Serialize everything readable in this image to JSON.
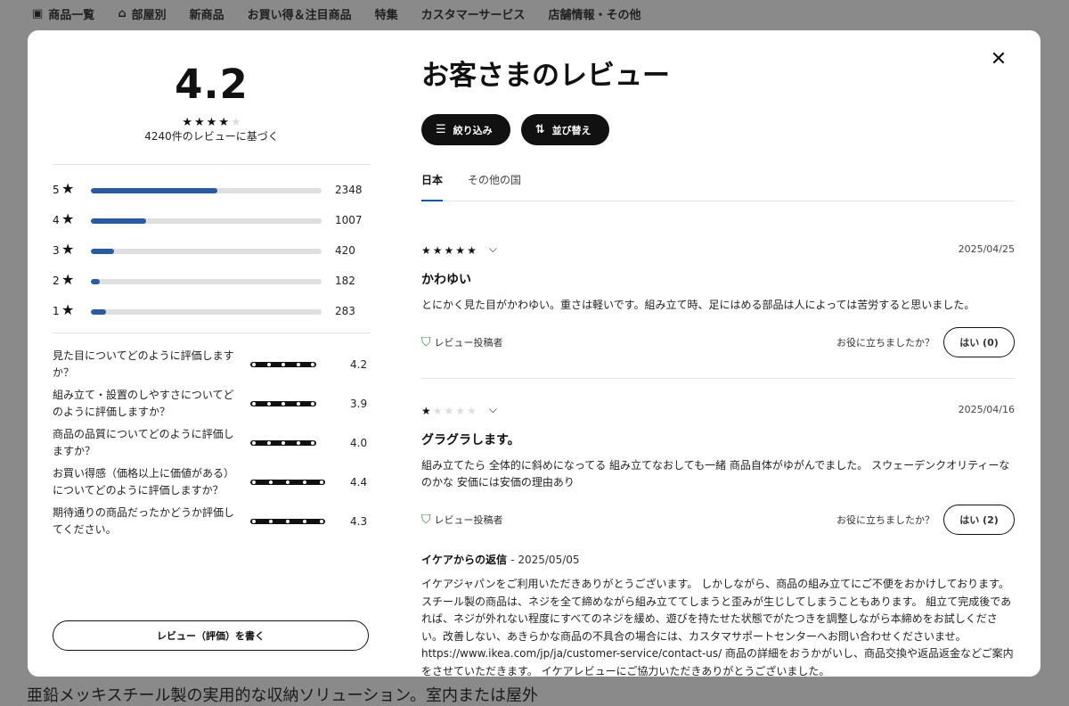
{
  "nav": {
    "items": [
      {
        "label": "商品一覧",
        "icon": "catalog-icon"
      },
      {
        "label": "部屋別",
        "icon": "home-icon"
      },
      {
        "label": "新商品"
      },
      {
        "label": "お買い得＆注目商品"
      },
      {
        "label": "特集"
      },
      {
        "label": "カスタマーサービス"
      },
      {
        "label": "店舗情報・その他"
      }
    ]
  },
  "background_text": "亜鉛メッキスチール製の実用的な収納ソリューション。室内または屋外",
  "summary": {
    "average": "4.2",
    "average_stars": 4,
    "caption": "4240件のレビューに基づく",
    "histogram": [
      {
        "stars": "5",
        "count": "2348",
        "fraction": 0.55
      },
      {
        "stars": "4",
        "count": "1007",
        "fraction": 0.24
      },
      {
        "stars": "3",
        "count": "420",
        "fraction": 0.1
      },
      {
        "stars": "2",
        "count": "182",
        "fraction": 0.04
      },
      {
        "stars": "1",
        "count": "283",
        "fraction": 0.065
      }
    ],
    "sub_ratings": [
      {
        "question": "見た目についてどのように評価しますか？",
        "value": "4.2"
      },
      {
        "question": "組み立て・設置のしやすさについてどのように評価しますか？",
        "value": "3.9"
      },
      {
        "question": "商品の品質についてどのように評価しますか？",
        "value": "4.0"
      },
      {
        "question": "お買い得感（価格以上に価値がある）についてどのように評価しますか？",
        "value": "4.4"
      },
      {
        "question": "期待通りの商品だったかどうか評価してください。",
        "value": "4.3"
      }
    ],
    "write_button": "レビュー（評価）を書く"
  },
  "reviews_panel": {
    "title": "お客さまのレビュー",
    "filter_button": "絞り込み",
    "sort_button": "並び替え",
    "tabs": [
      {
        "label": "日本",
        "active": true
      },
      {
        "label": "その他の国",
        "active": false
      }
    ],
    "reviews": [
      {
        "rating": 5,
        "date": "2025/04/25",
        "title": "かわゆい",
        "body": "とにかく見た目がかわゆい。重さは軽いです。組み立て時、足にはめる部品は人によっては苦労すると思いました。",
        "badge": "レビュー投稿者",
        "helpful_question": "お役に立ちましたか？",
        "helpful_button": "はい (0)"
      },
      {
        "rating": 1,
        "date": "2025/04/16",
        "title": "グラグラします。",
        "body": "組み立てたら 全体的に斜めになってる 組み立てなおしても一緒 商品自体がゆがんでました。 スウェーデンクオリティーなのかな 安価には安価の理由あり",
        "badge": "レビュー投稿者",
        "helpful_question": "お役に立ちましたか？",
        "helpful_button": "はい (2)",
        "reply": {
          "author": "イケアからの返信",
          "date": "- 2025/05/05",
          "body": "イケアジャパンをご利用いただきありがとうございます。 しかしながら、商品の組み立てにご不便をおかけしております。 スチール製の商品は、ネジを全て締めながら組み立ててしまうと歪みが生じしてしまうこともあります。 組立て完成後であれば、ネジが外れない程度にすべてのネジを緩め、遊びを持たせた状態でがたつきを調整しながら本締めをお試しください。改善しない、あきらかな商品の不具合の場合には、カスタマサポートセンターへお問い合わせくださいませ。 https://www.ikea.com/jp/ja/customer-service/contact-us/ 商品の詳細をおうかがいし、商品交換や返品返金などご案内をさせていただきます。 イケアレビューにご協力いただきありがとうございました。"
        }
      }
    ]
  }
}
